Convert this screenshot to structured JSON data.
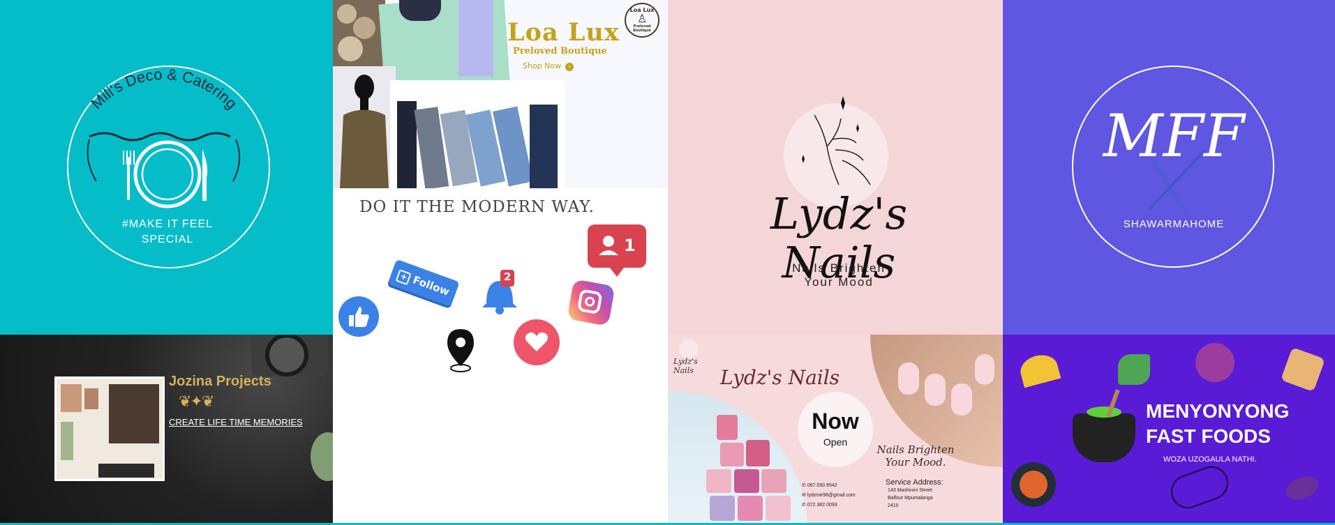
{
  "colors": {
    "teal": "#05bcc9",
    "pink": "#f4d6d9",
    "violet": "#5f57e1",
    "purple": "#5a1bd6",
    "gold": "#c4a21a",
    "facebook_blue": "#3b82e6",
    "red_badge": "#d9434f"
  },
  "mili": {
    "name": "Mili's Deco & Catering",
    "tagline_line1": "#MAKE IT FEEL",
    "tagline_line2": "SPECIAL",
    "icons": [
      "fork-icon",
      "plate-icon",
      "knife-icon",
      "ornament-icon"
    ]
  },
  "loalux": {
    "title": "Loa Lux",
    "subtitle": "Preloved Boutique",
    "shop_now": "Shop Now",
    "shop_arrow": "›",
    "badge_line1": "Loa Lux",
    "badge_line2": "Preloved Boutique"
  },
  "social": {
    "headline": "DO IT THE MODERN WAY.",
    "friend_count": "1",
    "follow_label": "Follow",
    "bell_count": "2",
    "icons": [
      "like-icon",
      "follow-button",
      "bell-icon",
      "instagram-icon",
      "location-pin-icon",
      "heart-icon",
      "friend-request-icon"
    ]
  },
  "lydz_top": {
    "brand": "Lydz's Nails",
    "tagline_line1": "Nails Brighten",
    "tagline_line2": "Your Mood"
  },
  "mff": {
    "monogram": "MFF",
    "name": "SHAWARMAHOME"
  },
  "jozina": {
    "title": "Jozina Projects",
    "tagline": "CREATE LIFE TIME MEMORIES"
  },
  "lydz_bottom": {
    "brand": "Lydz's Nails",
    "now": "Now",
    "open": "Open",
    "tagline_line1": "Nails Brighten",
    "tagline_line2": "Your Mood.",
    "phone1": "067 050 8542",
    "email": "lydzmir98@gmail.com",
    "phone2": "072 382 0093",
    "address_title": "Service Address:",
    "address_line1": "143 Mashinini Street",
    "address_line2": "Balfour Mpumalanga",
    "address_line3": "2410"
  },
  "menyonyong": {
    "title_line1": "MENYONYONG",
    "title_line2": "FAST FOODS",
    "tagline": "WOZA UZOGAULA NATHI."
  }
}
